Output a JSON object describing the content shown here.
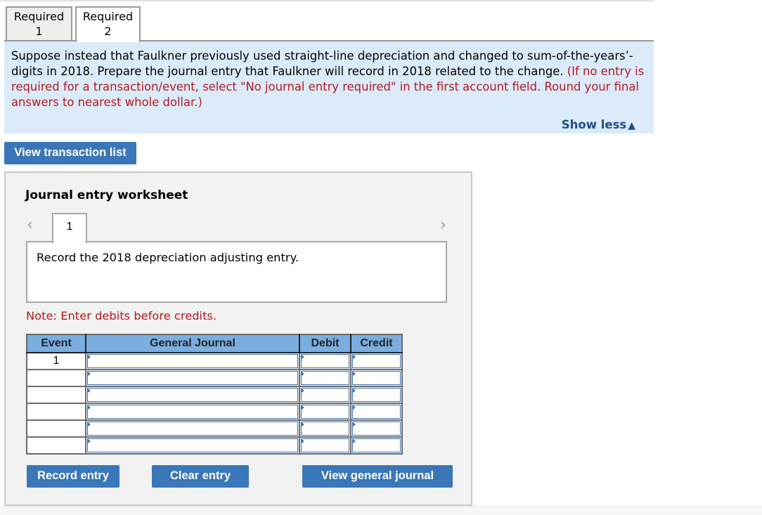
{
  "tabs": [
    {
      "line1": "Required",
      "line2": "1",
      "active": false
    },
    {
      "line1": "Required",
      "line2": "2",
      "active": true
    }
  ],
  "question": {
    "text": "Suppose instead that Faulkner previously used straight-line depreciation and changed to sum-of-the-years’- digits in 2018. Prepare the journal entry that Faulkner will record in 2018 related to the change.",
    "instruction": "(If no entry is required for a transaction/event, select \"No journal entry required\" in the first account field. Round your final answers to nearest whole dollar.)",
    "show_less_label": "Show less",
    "show_less_icon": "triangle-up-icon"
  },
  "view_transaction_list_label": "View transaction list",
  "worksheet": {
    "title": "Journal entry worksheet",
    "nav_prev_icon": "chevron-left-icon",
    "nav_next_icon": "chevron-right-icon",
    "current_tab": "1",
    "description": "Record the 2018 depreciation adjusting entry.",
    "note": "Note: Enter debits before credits.",
    "table": {
      "headers": [
        "Event",
        "General Journal",
        "Debit",
        "Credit"
      ],
      "rows": [
        {
          "event": "1",
          "account": "",
          "debit": "",
          "credit": ""
        },
        {
          "event": "",
          "account": "",
          "debit": "",
          "credit": ""
        },
        {
          "event": "",
          "account": "",
          "debit": "",
          "credit": ""
        },
        {
          "event": "",
          "account": "",
          "debit": "",
          "credit": ""
        },
        {
          "event": "",
          "account": "",
          "debit": "",
          "credit": ""
        },
        {
          "event": "",
          "account": "",
          "debit": "",
          "credit": ""
        }
      ]
    },
    "buttons": {
      "record": "Record entry",
      "clear": "Clear entry",
      "view_journal": "View general journal"
    }
  },
  "colors": {
    "question_bg": "#dcebf9",
    "instruction_red": "#b3191f",
    "button_blue": "#3a77b8",
    "header_blue": "#7aaee0",
    "link_blue": "#1d4f8a"
  }
}
